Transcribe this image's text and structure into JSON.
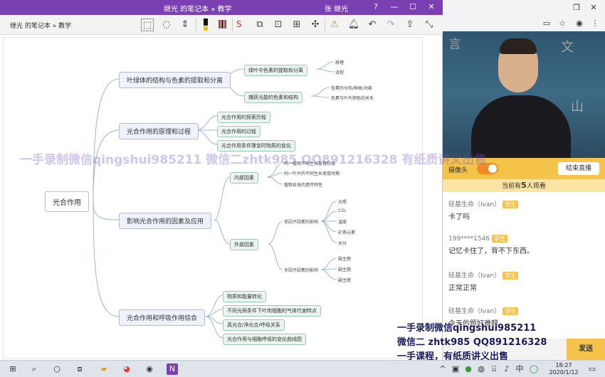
{
  "onenote": {
    "title": "继光 的笔记本 » 教学",
    "user": "张 继光",
    "breadcrumb": "继光 的笔记本 » 教学",
    "window_buttons": [
      "?",
      "—",
      "☐",
      "✕"
    ],
    "accent": "#7a3fb0"
  },
  "mindmap": {
    "root": "光合作用",
    "branches": [
      {
        "label": "叶绿体的结构与色素的提取和分离",
        "children": [
          {
            "label": "绿叶中色素的提取和分离",
            "leaves": [
              "原理",
              "流程"
            ]
          },
          {
            "label": "捕获光能的色素和结构",
            "leaves": [
              "色素的分布/种类/功能",
              "色素与叶片颜色的关系"
            ]
          }
        ]
      },
      {
        "label": "光合作用的原理和过程",
        "children": [
          {
            "label": "光合作用的探索历程"
          },
          {
            "label": "光合作用的过程"
          },
          {
            "label": "光合作用条件骤变时物质的变化"
          }
        ]
      },
      {
        "label": "影响光合作用的因素及应用",
        "children": [
          {
            "label": "内部因素",
            "leaves": [
              "同一植物不同生长发育阶段",
              "同一叶片的不同生长发育时期",
              "植物自身的遗传特性"
            ]
          },
          {
            "label": "外部因素",
            "groups": [
              {
                "label": "单因子因素的影响",
                "leaves": [
                  "光照",
                  "CO₂",
                  "温度",
                  "矿质元素",
                  "水分"
                ]
              },
              {
                "label": "多因子因素的影响",
                "leaves": [
                  "副主题",
                  "副主题",
                  "副主题"
                ]
              }
            ]
          }
        ]
      },
      {
        "label": "光合作用和呼吸作用综合",
        "children": [
          {
            "label": "物质和能量转化"
          },
          {
            "label": "不同光照条件下叶肉细胞的气体代谢特点"
          },
          {
            "label": "真光合/净光合/呼吸关系"
          },
          {
            "label": "光合作用与细胞呼吸的变化曲线图"
          }
        ]
      }
    ]
  },
  "live": {
    "camera_label": "摄像头",
    "end_live": "结束直播",
    "viewers_prefix": "当前有",
    "viewers_count": "5",
    "viewers_suffix": "人观看",
    "send": "发送",
    "messages": [
      {
        "user": "硅基生命（Ivan）",
        "badge": "学生",
        "text": "卡了吗"
      },
      {
        "user": "199****1546",
        "badge": "学生",
        "text": "记忆卡住了，背不下东西。"
      },
      {
        "user": "硅基生命（Ivan）",
        "badge": "学生",
        "text": "正常正常"
      },
      {
        "user": "硅基生命（Ivan）",
        "badge": "学生",
        "text": "今天的题好难啊"
      }
    ],
    "accent": "#f5c24a"
  },
  "watermarks": {
    "mid": "一手录制微信qingshui985211  微信二zhtk985  QQ891216328  有纸质讲义出售",
    "br1": "一手录制微信qingshui985211",
    "br2": "微信二 zhtk985   QQ891216328",
    "br3": "一手课程，有纸质讲义出售"
  },
  "taskbar": {
    "time": "18:27",
    "date": "2020/1/12",
    "ime": "中"
  }
}
